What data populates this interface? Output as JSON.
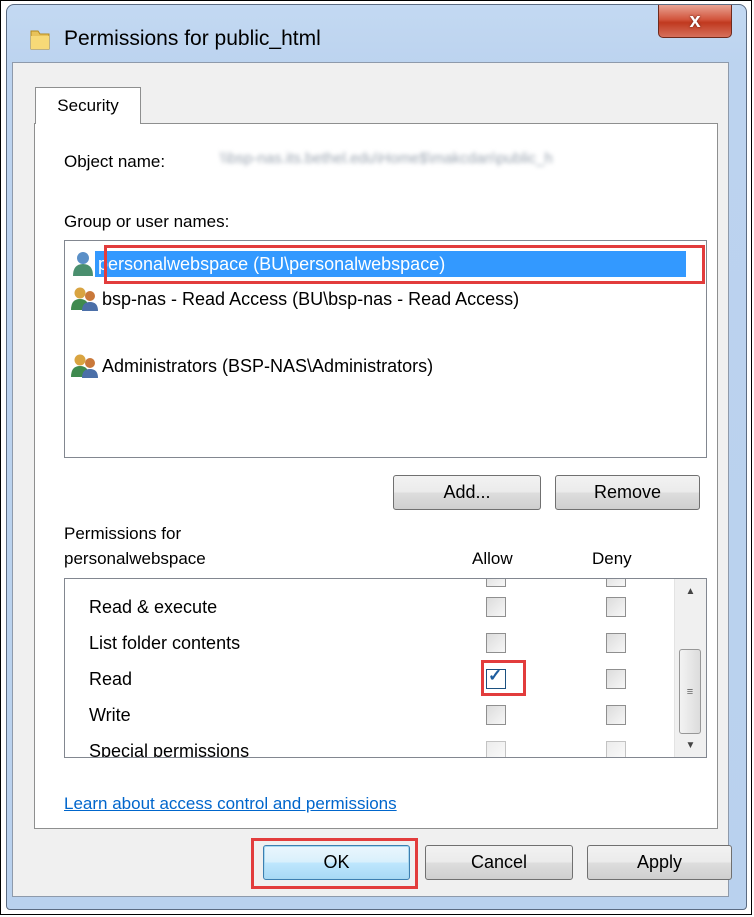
{
  "window": {
    "title": "Permissions for public_html",
    "close_label": "x"
  },
  "tabs": [
    {
      "label": "Security"
    }
  ],
  "object": {
    "label": "Object name:",
    "value": "\\\\bsp-nas.its.bethel.edu\\Home$\\makcdan\\public_h"
  },
  "group": {
    "label": "Group or user names:",
    "items": [
      {
        "label": "personalwebspace (BU\\personalwebspace)",
        "icon": "user-icon",
        "selected": true
      },
      {
        "label": "bsp-nas - Read Access (BU\\bsp-nas - Read Access)",
        "icon": "group-icon"
      },
      {
        "label": "Administrators (BSP-NAS\\Administrators)",
        "icon": "group-icon"
      }
    ]
  },
  "buttons": {
    "add": "Add...",
    "remove": "Remove",
    "ok": "OK",
    "cancel": "Cancel",
    "apply": "Apply"
  },
  "permissions": {
    "header_line1": "Permissions for",
    "header_line2": "personalwebspace",
    "allow_header": "Allow",
    "deny_header": "Deny",
    "rows": [
      {
        "name": "Read & execute",
        "allow": false,
        "deny": false
      },
      {
        "name": "List folder contents",
        "allow": false,
        "deny": false
      },
      {
        "name": "Read",
        "allow": true,
        "deny": false
      },
      {
        "name": "Write",
        "allow": false,
        "deny": false
      },
      {
        "name": "Special permissions",
        "allow": false,
        "deny": false,
        "disabled": true
      }
    ]
  },
  "link_text": "Learn about access control and permissions",
  "colors": {
    "selection": "#3399ff",
    "highlight_border": "#e23c3c",
    "link": "#0066cc"
  }
}
